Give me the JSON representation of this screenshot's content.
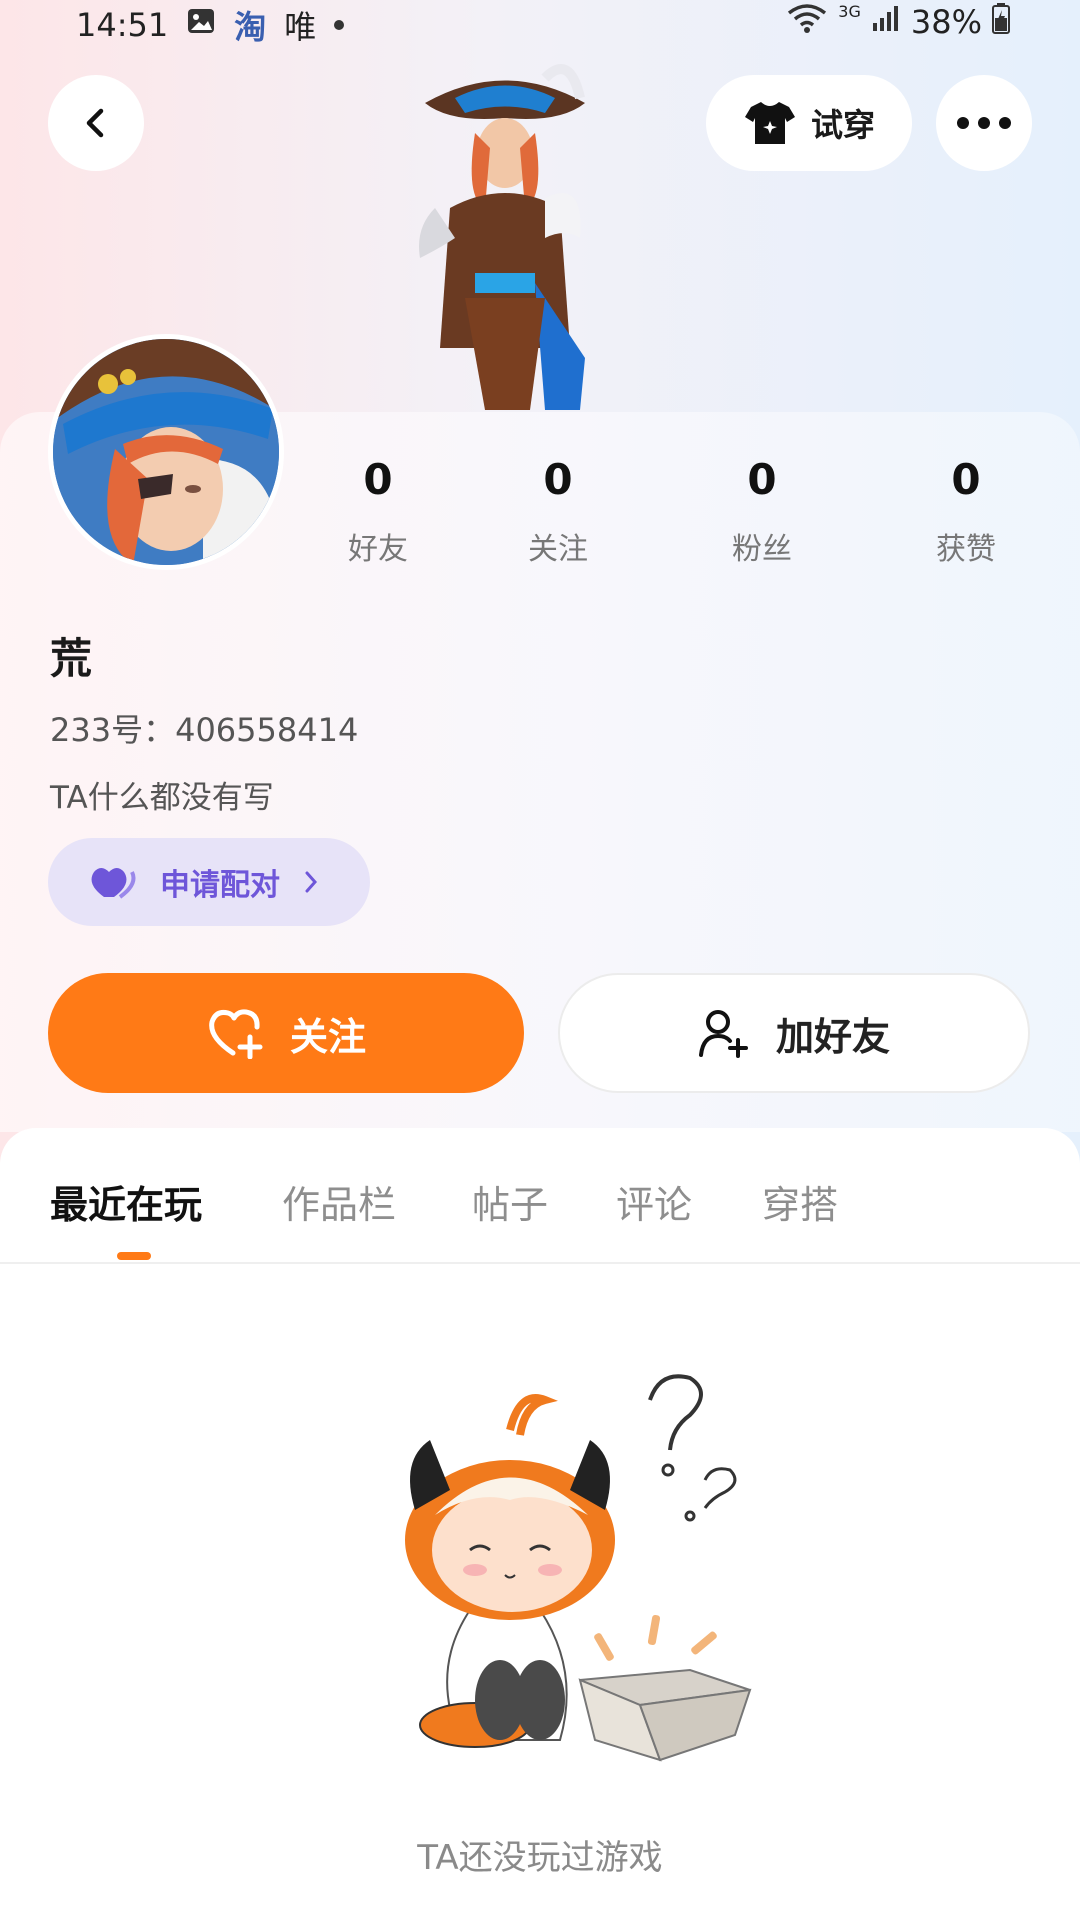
{
  "status_bar": {
    "time": "14:51",
    "app_icon_1": "image-icon",
    "app_text_taobao": "淘",
    "app_text_wei": "唯",
    "network": "3G",
    "battery": "38%"
  },
  "header": {
    "try_on_label": "试穿"
  },
  "profile": {
    "stats": [
      {
        "value": "0",
        "label": "好友"
      },
      {
        "value": "0",
        "label": "关注"
      },
      {
        "value": "0",
        "label": "粉丝"
      },
      {
        "value": "0",
        "label": "获赞"
      }
    ],
    "name": "荒",
    "uid": "233号：406558414",
    "bio": "TA什么都没有写",
    "pair_label": "申请配对"
  },
  "actions": {
    "follow_label": "关注",
    "add_friend_label": "加好友"
  },
  "tabs": [
    {
      "label": "最近在玩",
      "active": true
    },
    {
      "label": "作品栏",
      "active": false
    },
    {
      "label": "帖子",
      "active": false
    },
    {
      "label": "评论",
      "active": false
    },
    {
      "label": "穿搭",
      "active": false
    }
  ],
  "empty_state": {
    "text": "TA还没玩过游戏"
  },
  "colors": {
    "accent": "#ff7a16",
    "pair_bg": "#e7e3f8",
    "pair_fg": "#6e56d9"
  }
}
